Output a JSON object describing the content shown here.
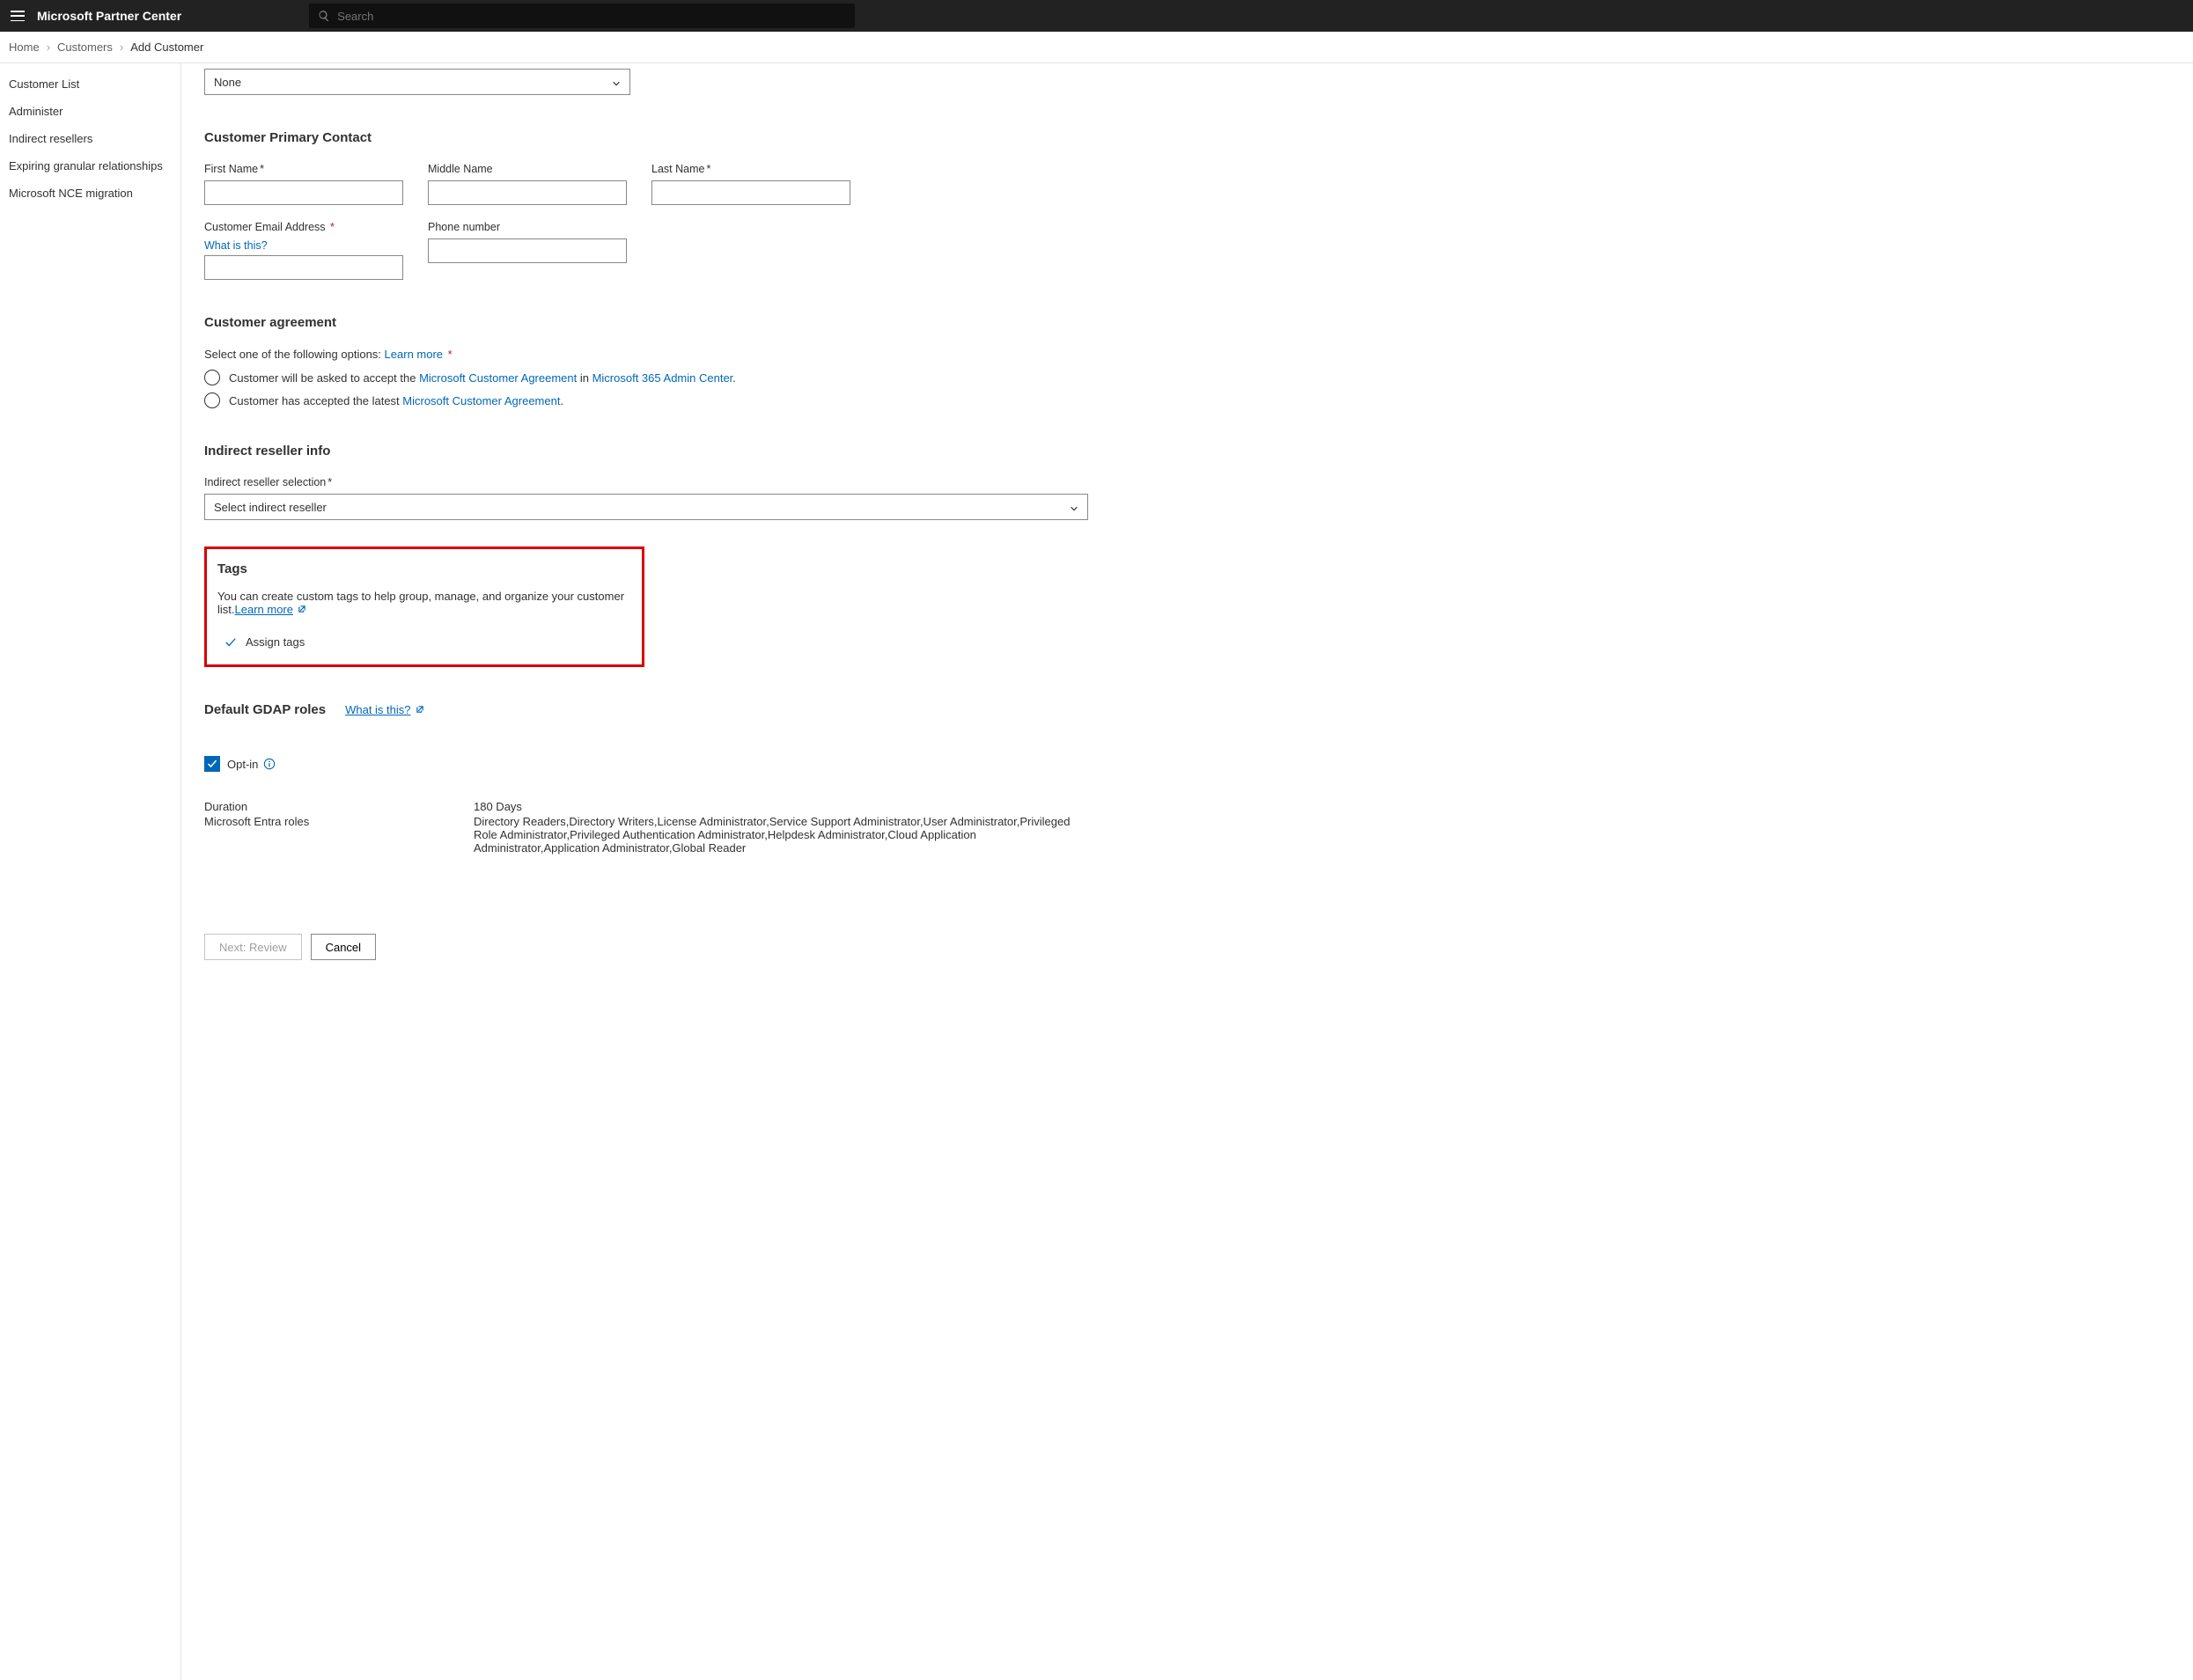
{
  "header": {
    "brand": "Microsoft Partner Center",
    "search_placeholder": "Search"
  },
  "breadcrumb": {
    "home": "Home",
    "customers": "Customers",
    "current": "Add Customer"
  },
  "sidebar": {
    "items": [
      "Customer List",
      "Administer",
      "Indirect resellers",
      "Expiring granular relationships",
      "Microsoft NCE migration"
    ]
  },
  "top_dropdown_value": "None",
  "contact": {
    "heading": "Customer Primary Contact",
    "first_name_label": "First Name",
    "middle_name_label": "Middle Name",
    "last_name_label": "Last Name",
    "email_label": "Customer Email Address",
    "email_help_link": "What is this?",
    "phone_label": "Phone number"
  },
  "agreement": {
    "heading": "Customer agreement",
    "select_text": "Select one of the following options:",
    "learn_more": "Learn more",
    "opt1_a": "Customer will be asked to accept the ",
    "opt1_link1": "Microsoft Customer Agreement",
    "opt1_b": " in ",
    "opt1_link2": "Microsoft 365 Admin Center",
    "opt1_c": ".",
    "opt2_a": "Customer has accepted the latest ",
    "opt2_link": "Microsoft Customer Agreement",
    "opt2_b": "."
  },
  "reseller": {
    "heading": "Indirect reseller info",
    "label": "Indirect reseller selection",
    "value": "Select indirect reseller"
  },
  "tags": {
    "heading": "Tags",
    "desc": "You can create custom tags to help group, manage, and organize your customer list.",
    "learn_more": "Learn  more",
    "assign": "Assign tags"
  },
  "gdap": {
    "heading": "Default GDAP roles",
    "what_is": "What is this?",
    "optin": "Opt-in",
    "duration_label": "Duration",
    "duration_value": "180 Days",
    "roles_label": "Microsoft Entra roles",
    "roles_value": "Directory Readers,Directory Writers,License Administrator,Service Support Administrator,User Administrator,Privileged Role Administrator,Privileged Authentication Administrator,Helpdesk Administrator,Cloud Application Administrator,Application Administrator,Global Reader"
  },
  "buttons": {
    "next": "Next: Review",
    "cancel": "Cancel"
  }
}
